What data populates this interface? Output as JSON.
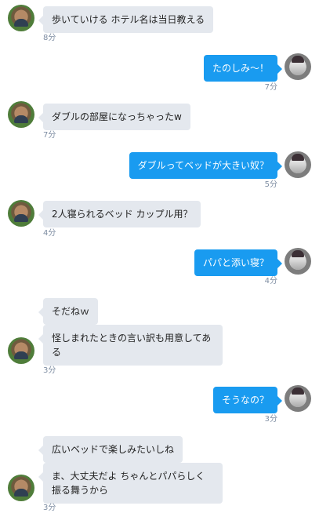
{
  "messages": [
    {
      "side": "left",
      "text": "歩いていける ホテル名は当日教える",
      "time": "8分"
    },
    {
      "side": "right",
      "text": "たのしみ〜！",
      "time": "7分"
    },
    {
      "side": "left",
      "text": "ダブルの部屋になっちゃったw",
      "time": "7分"
    },
    {
      "side": "right",
      "text": "ダブルってベッドが大きい奴？",
      "time": "5分"
    },
    {
      "side": "left",
      "text": "2人寝られるベッド カップル用？",
      "time": "4分"
    },
    {
      "side": "right",
      "text": "パパと添い寝？",
      "time": "4分"
    },
    {
      "side": "left",
      "text": "そだねｗ"
    },
    {
      "side": "left",
      "text": "怪しまれたときの言い訳も用意してある",
      "time": "3分"
    },
    {
      "side": "right",
      "text": "そうなの？",
      "time": "3分"
    },
    {
      "side": "left",
      "text": "広いベッドで楽しみたいしね"
    },
    {
      "side": "left",
      "text": "ま、大丈夫だよ ちゃんとパパらしく振る舞うから",
      "time": "3分"
    }
  ]
}
